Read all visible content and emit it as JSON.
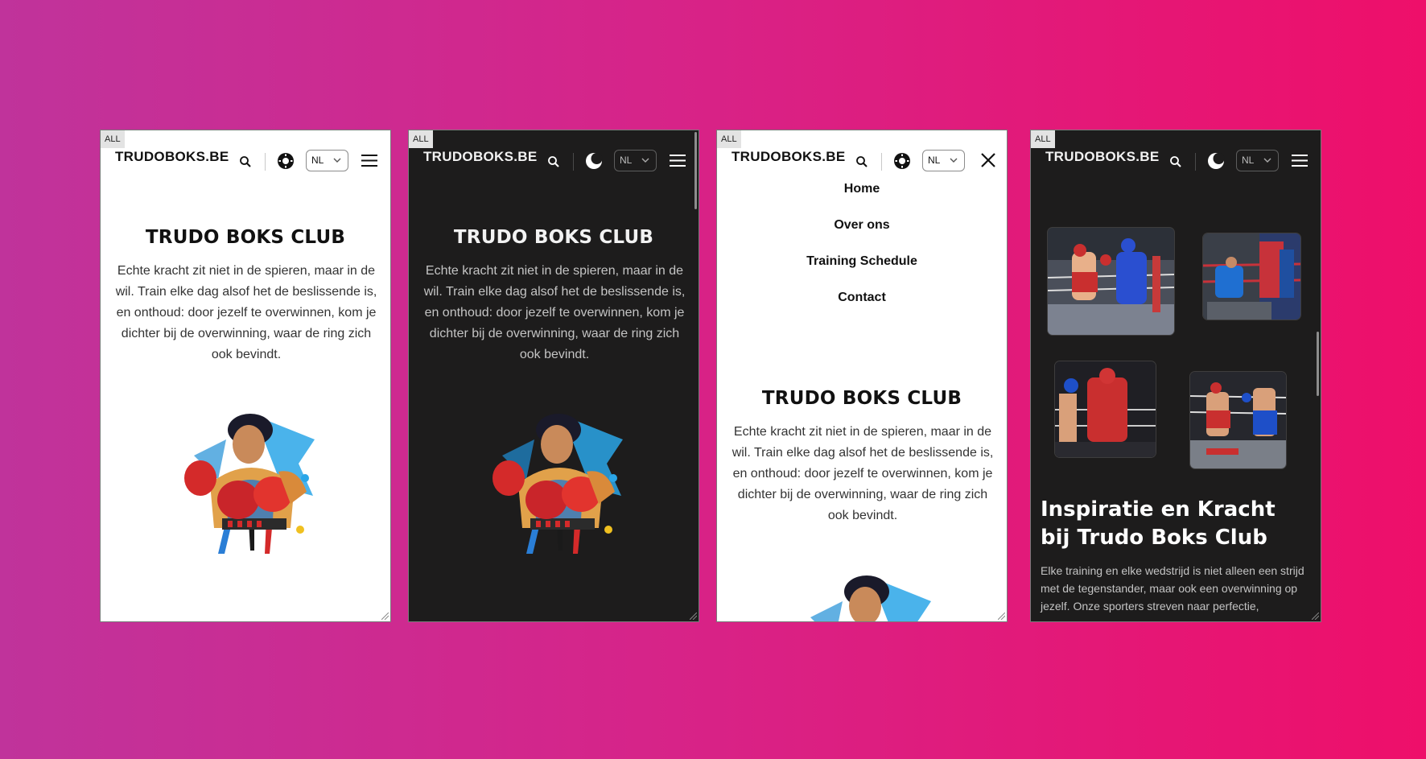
{
  "tag_label": "ALL",
  "brand": "TRUDOBOKS.BE",
  "lang": {
    "selected": "NL"
  },
  "hero": {
    "title": "TRUDO BOKS CLUB",
    "text": "Echte kracht zit niet in de spieren, maar in de wil. Train elke dag alsof het de beslissende is, en onthoud: door jezelf te overwinnen, kom je dichter bij de overwinning, waar de ring zich ook bevindt."
  },
  "nav": {
    "items": [
      {
        "label": "Home"
      },
      {
        "label": "Over ons"
      },
      {
        "label": "Training Schedule"
      },
      {
        "label": "Contact"
      }
    ]
  },
  "inspiration": {
    "title": "Inspiratie en Kracht bij Trudo Boks Club",
    "text": "Elke training en elke wedstrijd is niet alleen een strijd met de tegenstander, maar ook een overwinning op jezelf. Onze sporters streven naar perfectie,"
  },
  "colors": {
    "background_start": "#c0339b",
    "background_end": "#ee0f6a",
    "dark_surface": "#1d1c1c",
    "light_surface": "#ffffff",
    "glove_red": "#d42a2a",
    "corner_blue": "#2a4fd0"
  },
  "icons": [
    "search-icon",
    "theme-toggle-icon",
    "chevron-down-icon",
    "menu-icon",
    "close-icon"
  ]
}
